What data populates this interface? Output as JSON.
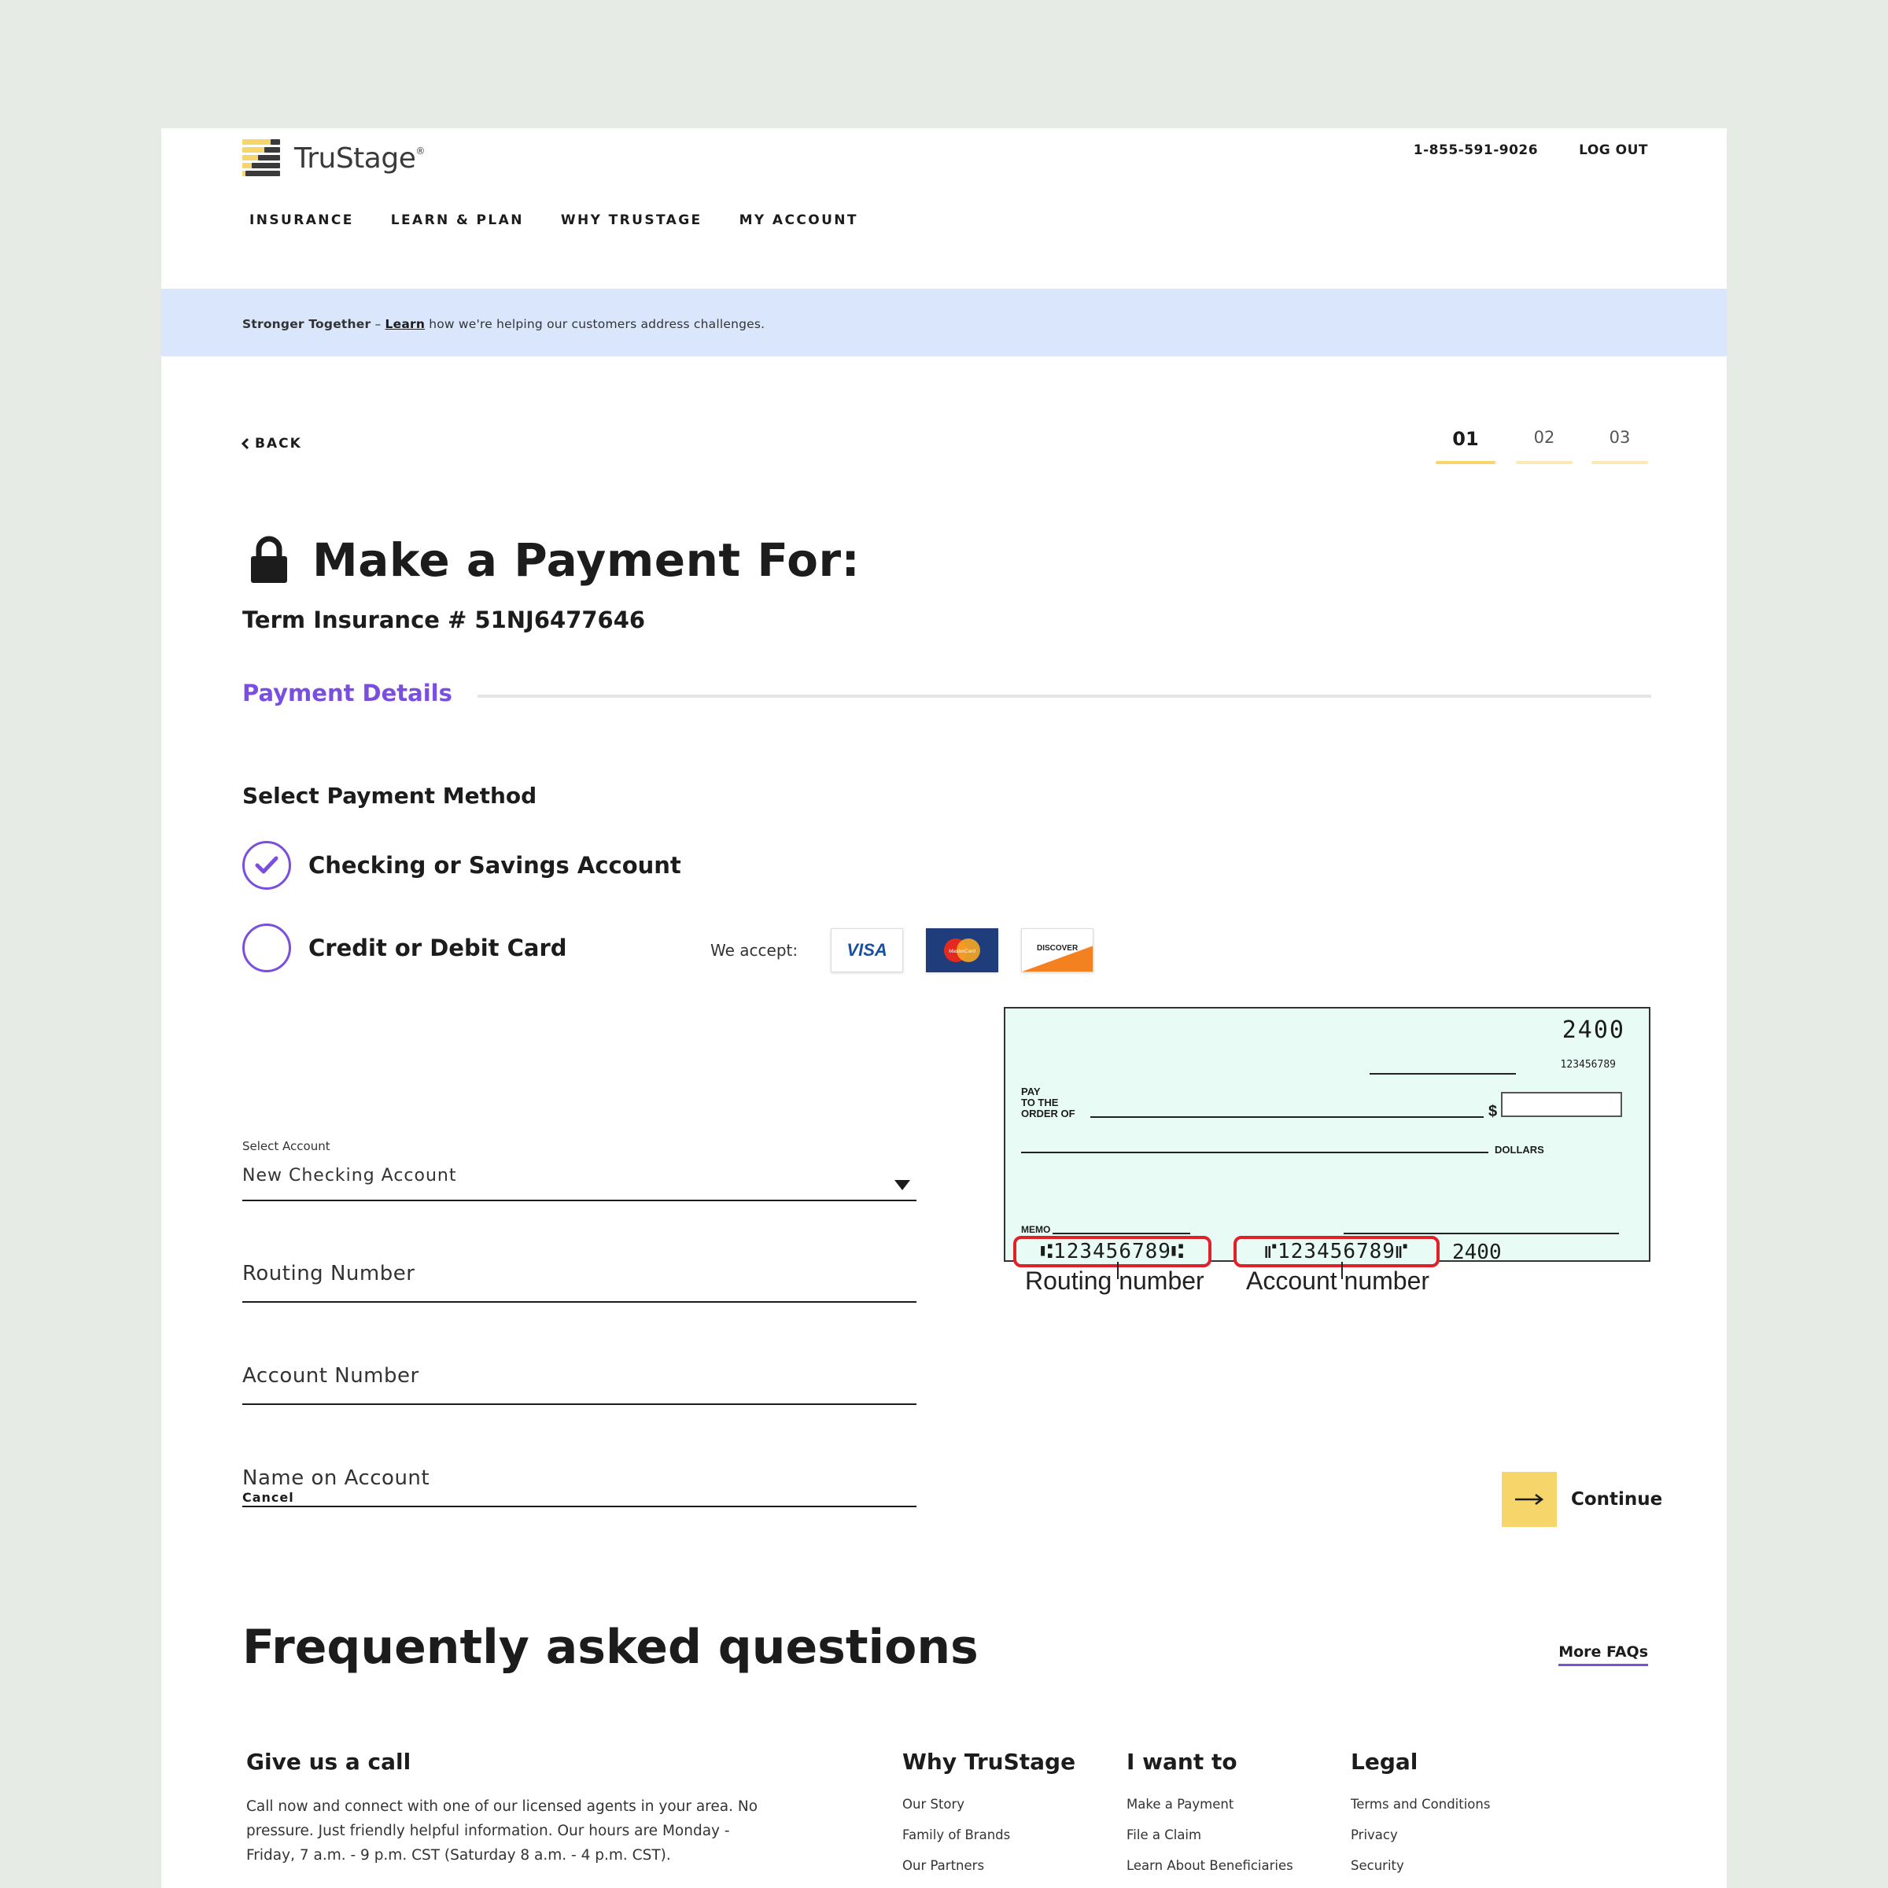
{
  "header": {
    "brand": "TruStage",
    "brand_mark": "®",
    "phone": "1-855-591-9026",
    "logout": "LOG OUT",
    "nav": [
      "INSURANCE",
      "LEARN & PLAN",
      "WHY TRUSTAGE",
      "MY ACCOUNT"
    ]
  },
  "banner": {
    "bold": "Stronger Together",
    "dash": " – ",
    "link": "Learn",
    "rest": " how we're helping our customers address challenges."
  },
  "progress": {
    "back": "BACK",
    "steps": [
      "01",
      "02",
      "03"
    ],
    "active_step": 1
  },
  "payment": {
    "title": "Make a Payment For:",
    "subtitle": "Term Insurance # 51NJ6477646",
    "section": "Payment Details",
    "method_heading": "Select Payment Method",
    "methods": [
      {
        "label": "Checking or Savings Account",
        "selected": true
      },
      {
        "label": "Credit or Debit Card",
        "selected": false
      }
    ],
    "we_accept": "We accept:",
    "cards": [
      "VISA",
      "MasterCard",
      "DISCOVER"
    ]
  },
  "form": {
    "select_label": "Select Account",
    "select_value": "New Checking Account",
    "routing": "Routing Number",
    "account": "Account Number",
    "name": "Name on Account"
  },
  "check": {
    "check_number": "2400",
    "small_number": "123456789",
    "pay_to": [
      "PAY",
      "TO THE",
      "ORDER OF"
    ],
    "dollar_sign": "$",
    "dollars": "DOLLARS",
    "memo": "MEMO",
    "routing_micr": "⑆123456789⑆",
    "account_micr": "⑈123456789⑈",
    "check_micr": "2400",
    "routing_caption": "Routing number",
    "account_caption": "Account number"
  },
  "actions": {
    "cancel": "Cancel",
    "continue": "Continue"
  },
  "faq": {
    "title": "Frequently asked questions",
    "more": "More FAQs"
  },
  "footer": {
    "call_title": "Give us a call",
    "call_text": "Call now and connect with one of our licensed agents in your area. No pressure. Just friendly helpful information. Our hours are Monday - Friday, 7 a.m. - 9 p.m. CST (Saturday 8 a.m. - 4 p.m. CST).",
    "columns": [
      {
        "title": "Why TruStage",
        "links": [
          "Our Story",
          "Family of Brands",
          "Our Partners"
        ]
      },
      {
        "title": "I want to",
        "links": [
          "Make a Payment",
          "File a Claim",
          "Learn About Beneficiaries"
        ]
      },
      {
        "title": "Legal",
        "links": [
          "Terms and Conditions",
          "Privacy",
          "Security"
        ]
      }
    ]
  },
  "colors": {
    "accent_purple": "#7a4fe0",
    "accent_yellow": "#f6d66a",
    "banner_blue": "#d9e6fb",
    "check_green": "#e8fbf4",
    "highlight_red": "#e0202a"
  }
}
